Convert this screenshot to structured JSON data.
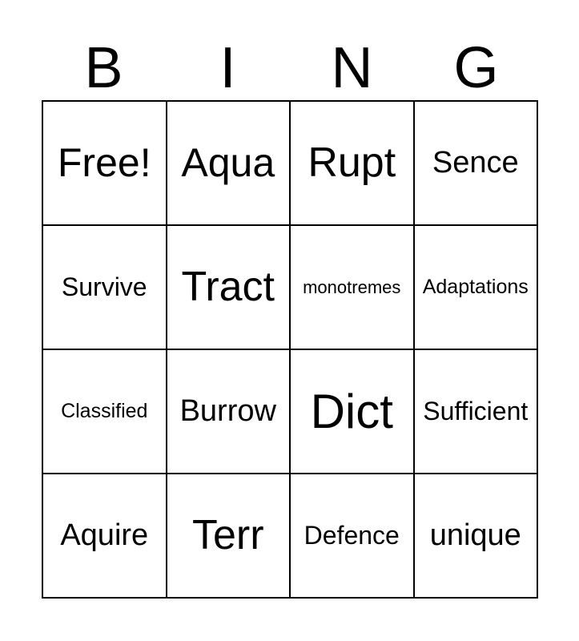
{
  "header": {
    "letters": [
      "B",
      "I",
      "N",
      "G"
    ]
  },
  "grid": {
    "columns": 4,
    "rows": 4,
    "cells": [
      {
        "text": "Free!",
        "size": "fs-lg"
      },
      {
        "text": "Aqua",
        "size": "fs-lg"
      },
      {
        "text": "Rupt",
        "size": "fs-xl"
      },
      {
        "text": "Sence",
        "size": "fs-md"
      },
      {
        "text": "Survive",
        "size": "fs-sm"
      },
      {
        "text": "Tract",
        "size": "fs-xl"
      },
      {
        "text": "monotremes",
        "size": "fs-xxs"
      },
      {
        "text": "Adaptations",
        "size": "fs-xs"
      },
      {
        "text": "Classified",
        "size": "fs-xs"
      },
      {
        "text": "Burrow",
        "size": "fs-md"
      },
      {
        "text": "Dict",
        "size": "fs-xxl"
      },
      {
        "text": "Sufficient",
        "size": "fs-sm"
      },
      {
        "text": "Aquire",
        "size": "fs-md"
      },
      {
        "text": "Terr",
        "size": "fs-xl"
      },
      {
        "text": "Defence",
        "size": "fs-sm"
      },
      {
        "text": "unique",
        "size": "fs-md"
      }
    ]
  },
  "colors": {
    "border": "#000000",
    "text": "#000000",
    "background": "#ffffff"
  }
}
